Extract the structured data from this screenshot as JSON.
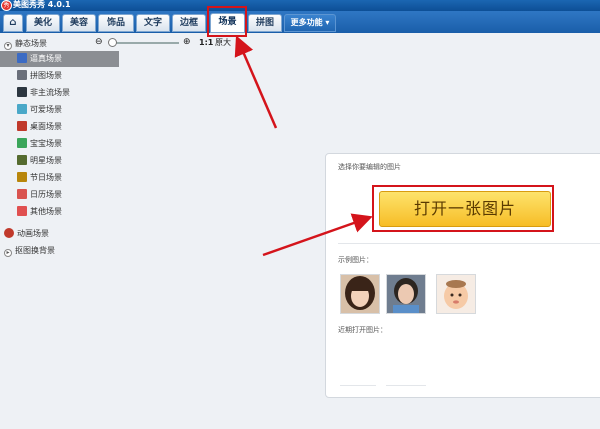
{
  "app": {
    "title": "美图秀秀 4.0.1",
    "logo_glyph": "秀"
  },
  "tabs": [
    {
      "id": "home",
      "label": "⌂"
    },
    {
      "id": "beautify",
      "label": "美化"
    },
    {
      "id": "makeup",
      "label": "美容"
    },
    {
      "id": "accessories",
      "label": "饰品"
    },
    {
      "id": "text",
      "label": "文字"
    },
    {
      "id": "frame",
      "label": "边框"
    },
    {
      "id": "scene",
      "label": "场景"
    },
    {
      "id": "collage",
      "label": "拼图"
    },
    {
      "id": "more",
      "label": "更多功能 ▾"
    }
  ],
  "active_tab": "场景",
  "sidebar": {
    "static_group": {
      "label": "静态场景"
    },
    "items": [
      {
        "label": "逼真场景",
        "selected": true,
        "icon": "realistic-scene-icon",
        "color": "#3b6bc4"
      },
      {
        "label": "拼图场景",
        "selected": false,
        "icon": "collage-scene-icon",
        "color": "#6a6f7a"
      },
      {
        "label": "非主流场景",
        "selected": false,
        "icon": "alternative-scene-icon",
        "color": "#2c3640"
      },
      {
        "label": "可爱场景",
        "selected": false,
        "icon": "cute-scene-icon",
        "color": "#4aa8c8"
      },
      {
        "label": "桌面场景",
        "selected": false,
        "icon": "desktop-scene-icon",
        "color": "#c0392b"
      },
      {
        "label": "宝宝场景",
        "selected": false,
        "icon": "baby-scene-icon",
        "color": "#3aa55a"
      },
      {
        "label": "明星场景",
        "selected": false,
        "icon": "star-scene-icon",
        "color": "#556b2f"
      },
      {
        "label": "节日场景",
        "selected": false,
        "icon": "holiday-scene-icon",
        "color": "#b8860b"
      },
      {
        "label": "日历场景",
        "selected": false,
        "icon": "calendar-scene-icon",
        "color": "#d9534f"
      },
      {
        "label": "其他场景",
        "selected": false,
        "icon": "other-scene-icon",
        "color": "#e05050"
      }
    ],
    "animated_group": {
      "label": "动画场景",
      "icon": "animation-scene-icon"
    },
    "cutout_group": {
      "label": "抠图换背景"
    }
  },
  "toolbar": {
    "zoom_out_icon": "zoom-out-icon",
    "zoom_in_icon": "zoom-in-icon",
    "ratio_icon_text": "1:1",
    "original_size_label": "原大",
    "zoom_level": 0
  },
  "open_panel": {
    "select_prompt": "选择你要编辑的图片",
    "open_button_label": "打开一张图片",
    "samples_label": "示例图片：",
    "recent_label": "近期打开图片："
  },
  "colors": {
    "title_bar": "#0d4f96",
    "tab_bar": "#2f77c4",
    "open_button": "#f9c935",
    "highlight": "#d4141b",
    "sidebar_selected": "#8b8e93"
  }
}
